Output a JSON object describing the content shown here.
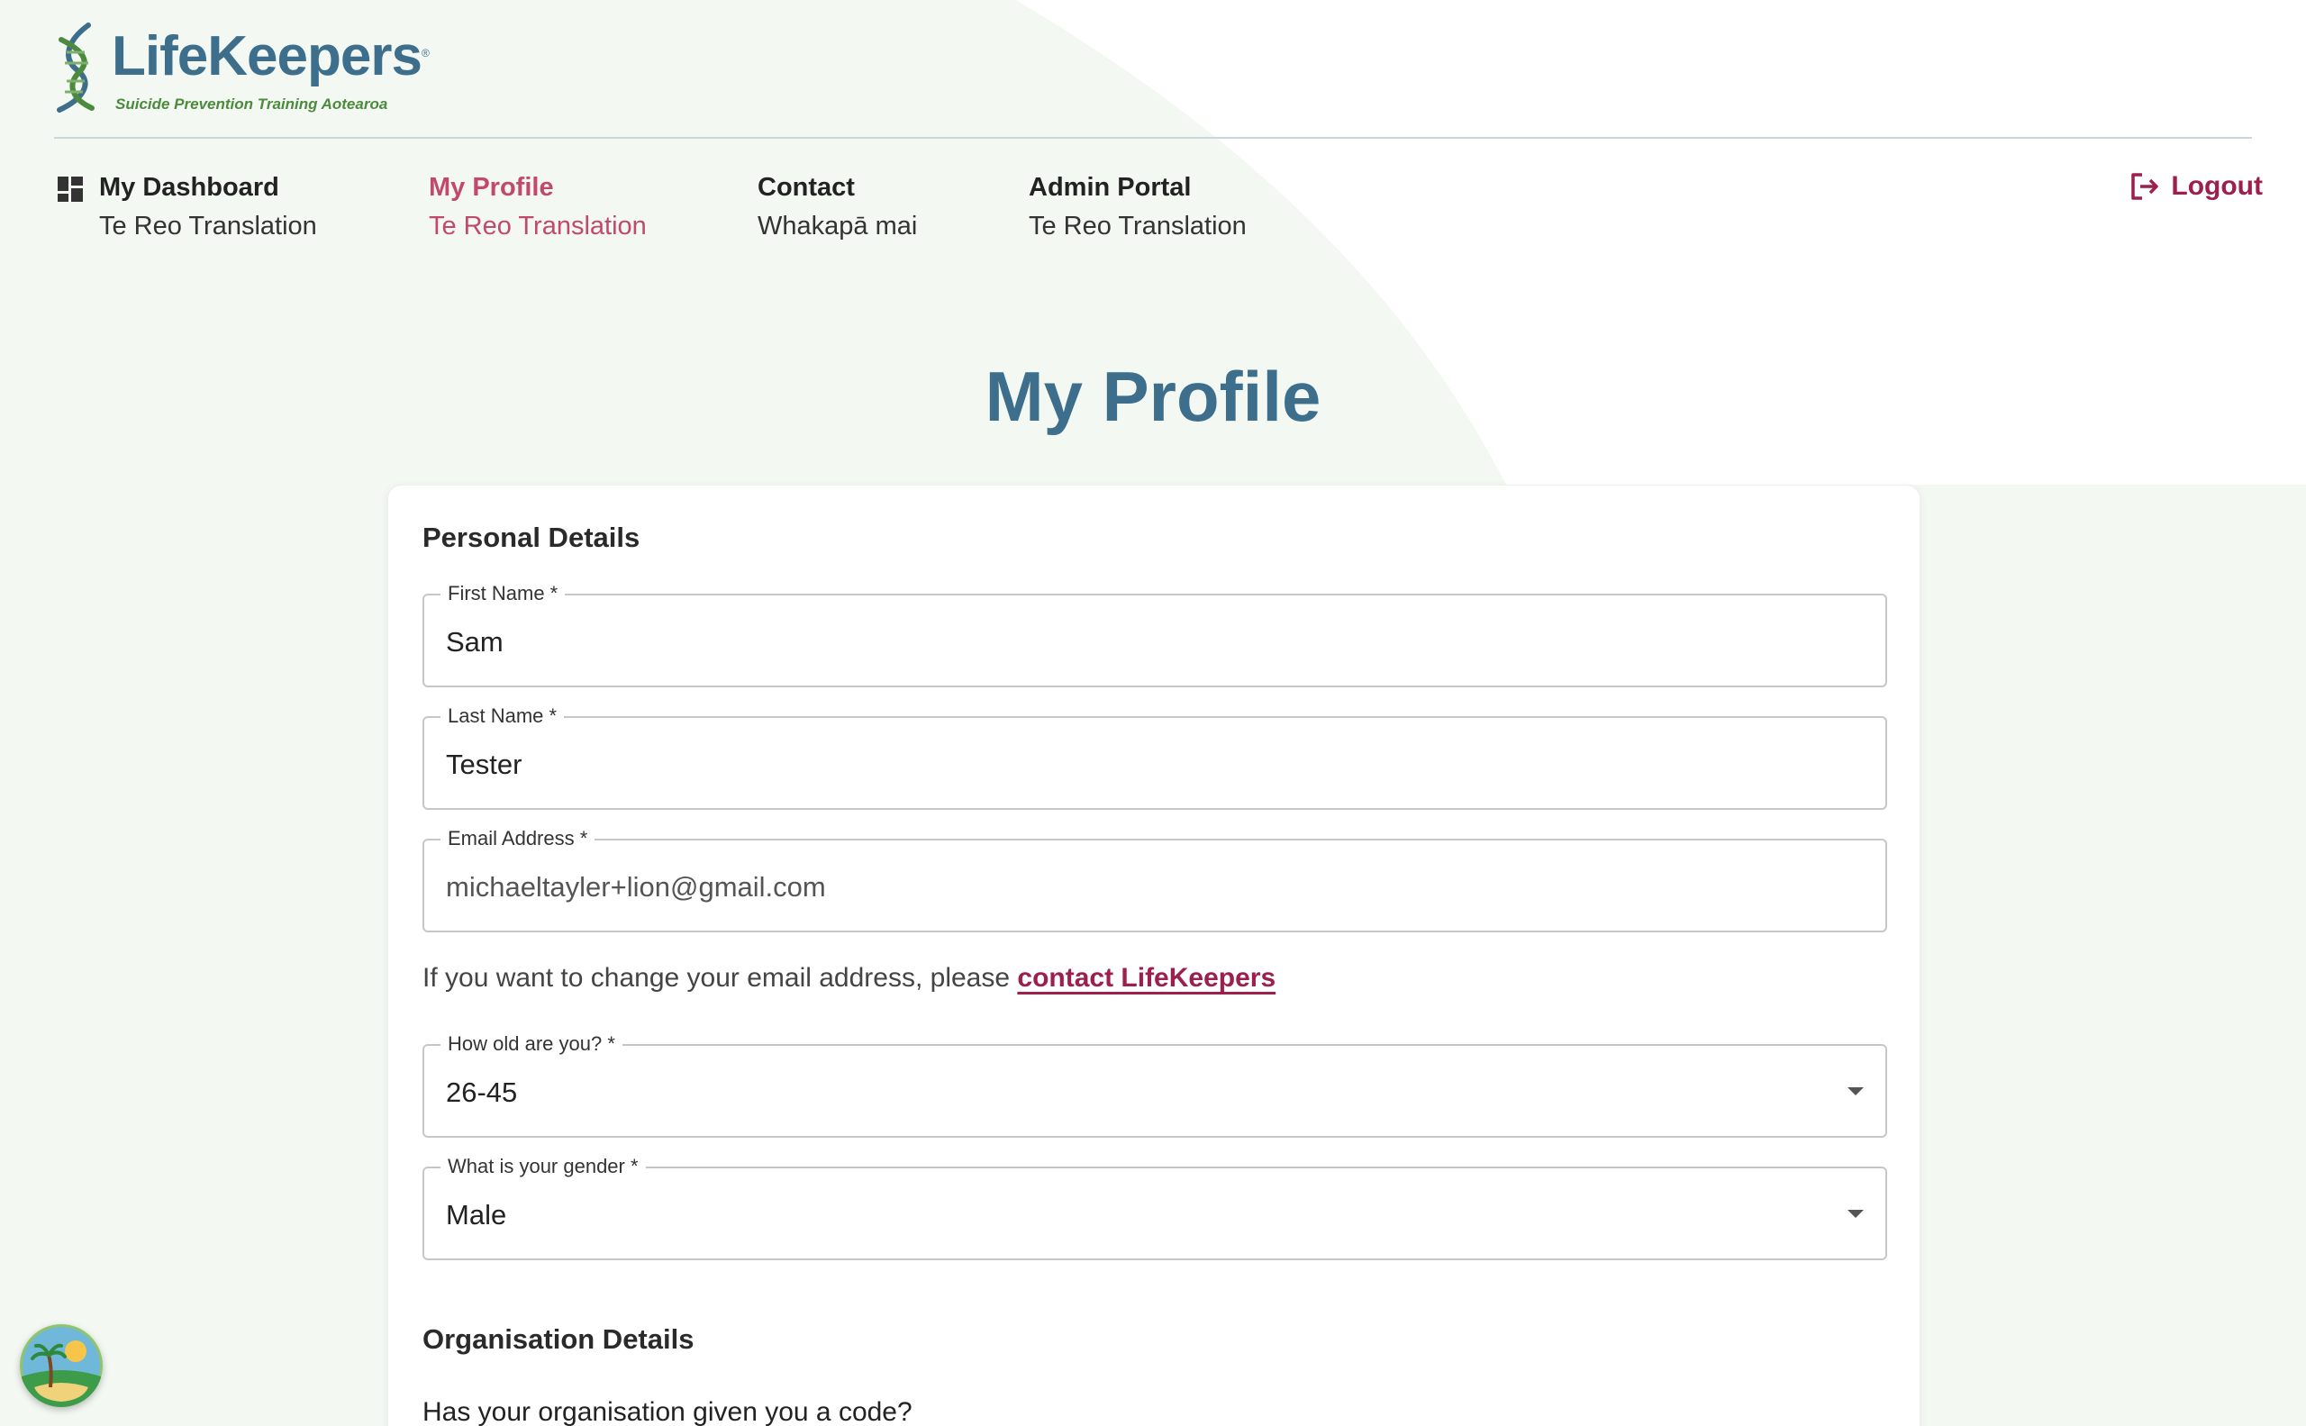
{
  "brand": {
    "name": "LifeKeepers",
    "tagline": "Suicide Prevention Training Aotearoa"
  },
  "nav": {
    "items": [
      {
        "title": "My Dashboard",
        "subtitle": "Te Reo Translation",
        "active": false,
        "icon": "dashboard-icon"
      },
      {
        "title": "My Profile",
        "subtitle": "Te Reo Translation",
        "active": true
      },
      {
        "title": "Contact",
        "subtitle": "Whakapā mai",
        "active": false
      },
      {
        "title": "Admin Portal",
        "subtitle": "Te Reo Translation",
        "active": false
      }
    ],
    "logout_label": "Logout",
    "logout_icon": "logout-icon"
  },
  "page": {
    "title": "My Profile"
  },
  "personal": {
    "section_title": "Personal Details",
    "first_name": {
      "label": "First Name *",
      "value": "Sam"
    },
    "last_name": {
      "label": "Last Name *",
      "value": "Tester"
    },
    "email": {
      "label": "Email Address *",
      "value": "michaeltayler+lion@gmail.com"
    },
    "email_help_text": "If you want to change your email address, please ",
    "email_help_link": "contact LifeKeepers",
    "age": {
      "label": "How old are you? *",
      "value": "26-45"
    },
    "gender": {
      "label": "What is your gender *",
      "value": "Male"
    }
  },
  "organisation": {
    "section_title": "Organisation Details",
    "code_question": "Has your organisation given you a code?"
  },
  "colors": {
    "brand_blue": "#3d6f8c",
    "accent_pink": "#c2496b",
    "logout_maroon": "#9c1f4d",
    "brand_green": "#4c8a3d",
    "background_tint": "#f3f8f2"
  }
}
